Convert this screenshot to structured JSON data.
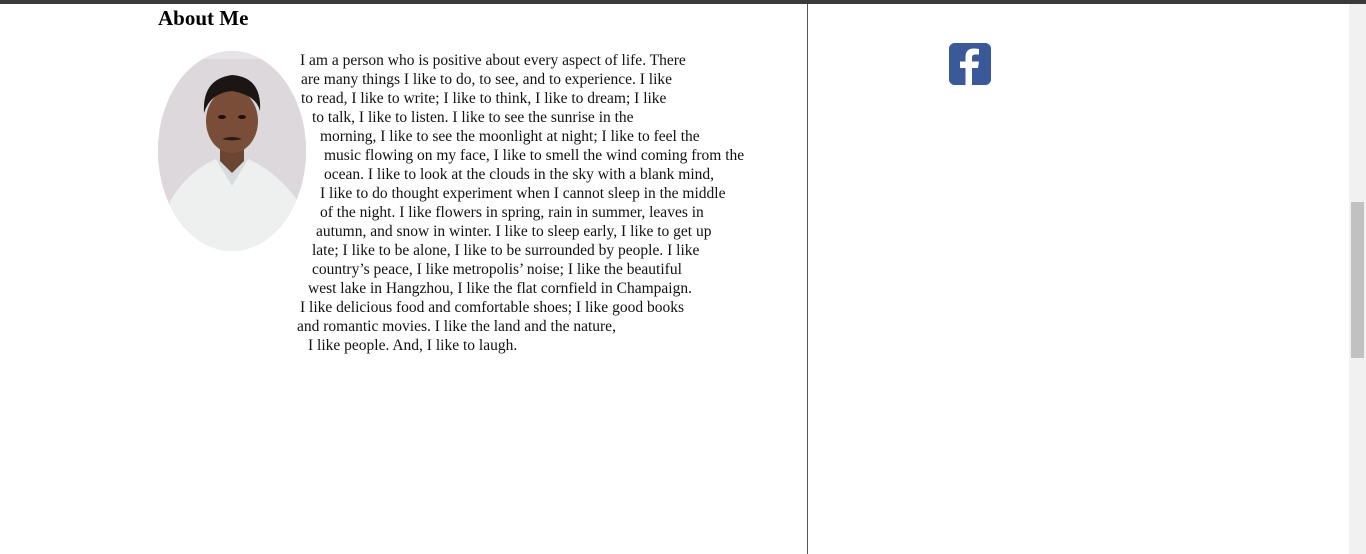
{
  "about": {
    "heading": "About Me",
    "photo_alt": "profile photo",
    "bio_lines": [
      "I am a person who is positive about every aspect of life. There",
      "are many things I like to do, to see, and to experience. I like",
      "to read, I like to write; I like to think, I like to dream; I like",
      "to talk, I like to listen. I like to see the sunrise in the",
      "morning, I like to see the moonlight at night; I like to feel the",
      "music flowing on my face, I like to smell the wind coming from the",
      "ocean. I like to look at the clouds in the sky with a blank mind,",
      "I like to do thought experiment when I cannot sleep in the middle",
      "of the night. I like flowers in spring, rain in summer, leaves in",
      "autumn, and snow in winter. I like to sleep early, I like to get up",
      "late; I like to be alone, I like to be surrounded by people. I like",
      "country’s peace, I like metropolis’ noise; I like the beautiful",
      "west lake in Hangzhou, I like the flat cornfield in Champaign.",
      "I like delicious food and comfortable shoes; I like good books",
      "and romantic movies. I like the land and the nature,",
      "I like people. And, I like to laugh."
    ]
  },
  "social": {
    "icon": "facebook-icon",
    "color": "#3b5998"
  }
}
